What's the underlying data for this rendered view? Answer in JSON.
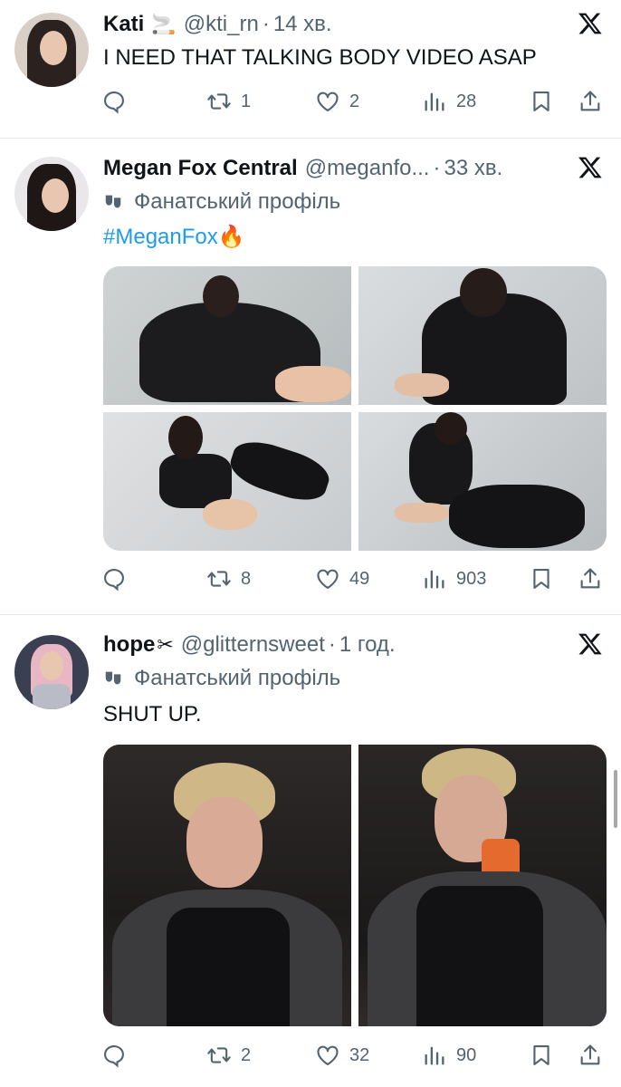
{
  "tweets": [
    {
      "name": "Kati",
      "name_glyph": "🚬",
      "handle": "@kti_rn",
      "time": "14 хв.",
      "text": "I NEED THAT TALKING BODY VIDEO ASAP",
      "replies": "",
      "retweets": "1",
      "likes": "2",
      "views": "28"
    },
    {
      "name": "Megan Fox Central",
      "handle": "@meganfo...",
      "time": "33 хв.",
      "profile_label": "Фанатський профіль",
      "hashtag": "#MeganFox",
      "hashtag_emoji": "🔥",
      "replies": "",
      "retweets": "8",
      "likes": "49",
      "views": "903"
    },
    {
      "name": "hope",
      "name_glyph": "✂",
      "handle": "@glitternsweet",
      "time": "1 год.",
      "profile_label": "Фанатський профіль",
      "text": "SHUT UP.",
      "replies": "",
      "retweets": "2",
      "likes": "32",
      "views": "90"
    }
  ],
  "dot_separator": "·",
  "icons": {
    "reply": "reply-icon",
    "retweet": "retweet-icon",
    "like": "heart-icon",
    "views": "views-icon",
    "bookmark": "bookmark-icon",
    "share": "share-icon",
    "platform": "x-logo-icon",
    "profile": "mask-icon"
  },
  "colors": {
    "text": "#0f1419",
    "secondary": "#536471",
    "link": "#1d9bf0",
    "divider": "#e6e9ec"
  }
}
